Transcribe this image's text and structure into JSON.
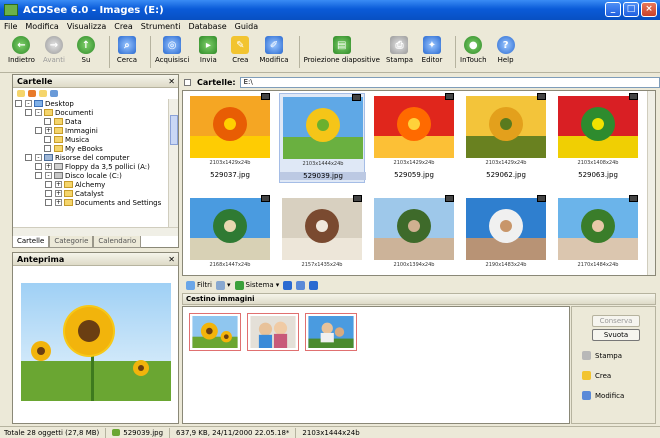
{
  "window": {
    "title": "ACDSee 6.0 - Images (E:)"
  },
  "menu": [
    "File",
    "Modifica",
    "Visualizza",
    "Crea",
    "Strumenti",
    "Database",
    "Guida"
  ],
  "toolbar": [
    {
      "label": "Indietro",
      "icon": "back-arrow-icon"
    },
    {
      "label": "Avanti",
      "icon": "forward-arrow-icon"
    },
    {
      "label": "Su",
      "icon": "up-arrow-icon"
    },
    {
      "label": "Cerca",
      "icon": "search-icon"
    },
    {
      "label": "Acquisisci",
      "icon": "acquire-icon"
    },
    {
      "label": "Invia",
      "icon": "send-icon"
    },
    {
      "label": "Crea",
      "icon": "create-icon"
    },
    {
      "label": "Modifica",
      "icon": "edit-icon"
    },
    {
      "label": "Proiezione diapositive",
      "icon": "slideshow-icon"
    },
    {
      "label": "Stampa",
      "icon": "print-icon"
    },
    {
      "label": "Editor",
      "icon": "editor-icon"
    },
    {
      "label": "InTouch",
      "icon": "intouch-icon"
    },
    {
      "label": "Help",
      "icon": "help-icon"
    }
  ],
  "folders": {
    "title": "Cartelle",
    "tree": [
      {
        "label": "Desktop",
        "indent": 0
      },
      {
        "label": "Documenti",
        "indent": 1
      },
      {
        "label": "Data",
        "indent": 2
      },
      {
        "label": "Immagini",
        "indent": 2
      },
      {
        "label": "Musica",
        "indent": 2
      },
      {
        "label": "My eBooks",
        "indent": 2
      },
      {
        "label": "Risorse del computer",
        "indent": 1
      },
      {
        "label": "Floppy da 3,5 pollici (A:)",
        "indent": 2
      },
      {
        "label": "Disco locale (C:)",
        "indent": 2
      },
      {
        "label": "Alchemy",
        "indent": 3
      },
      {
        "label": "Catalyst",
        "indent": 3
      },
      {
        "label": "Documents and Settings",
        "indent": 3
      }
    ],
    "tabs": [
      "Cartelle",
      "Categorie",
      "Calendario"
    ]
  },
  "preview": {
    "title": "Anteprima"
  },
  "address": {
    "label": "Cartelle:",
    "value": "E:\\"
  },
  "thumbnails": [
    {
      "meta": "2103x1429x24b",
      "name": "529037.jpg",
      "colors": [
        "#f5a623",
        "#e85d04",
        "#ffd000"
      ]
    },
    {
      "meta": "2103x1444x24b",
      "name": "529039.jpg",
      "colors": [
        "#5fa8e6",
        "#f5c518",
        "#6bb02e"
      ],
      "selected": true
    },
    {
      "meta": "2103x1429x24b",
      "name": "529059.jpg",
      "colors": [
        "#e0261c",
        "#ff6a00",
        "#ffd23a"
      ]
    },
    {
      "meta": "2103x1429x24b",
      "name": "529062.jpg",
      "colors": [
        "#f3c43a",
        "#e3a01c",
        "#5a7a1e"
      ]
    },
    {
      "meta": "2103x1408x24b",
      "name": "529063.jpg",
      "colors": [
        "#d91f24",
        "#2e8b2e",
        "#f2e200"
      ]
    },
    {
      "meta": "2168x1447x24b",
      "name": "",
      "colors": [
        "#4a9be0",
        "#2f7a33",
        "#e8d7b0"
      ]
    },
    {
      "meta": "2157x1435x24b",
      "name": "",
      "colors": [
        "#d8d0c0",
        "#7a4a30",
        "#f0e8dc"
      ]
    },
    {
      "meta": "2100x1394x24b",
      "name": "",
      "colors": [
        "#9ec8ea",
        "#3e6a2a",
        "#d0b090"
      ]
    },
    {
      "meta": "2190x1483x24b",
      "name": "",
      "colors": [
        "#2f7fcf",
        "#f0f0f0",
        "#c8966a"
      ]
    },
    {
      "meta": "2170x1484x24b",
      "name": "",
      "colors": [
        "#6bb4ea",
        "#3a7d2a",
        "#e8c8a8"
      ]
    }
  ],
  "filterbar": {
    "filters": "Filtri",
    "sort": "Sistema"
  },
  "basket": {
    "title": "Cestino immagini",
    "buttons": {
      "save": "Conserva",
      "empty": "Svuota"
    },
    "actions": [
      "Stampa",
      "Crea",
      "Modifica"
    ]
  },
  "status": {
    "total": "Totale 28 oggetti  (27,8 MB)",
    "file": "529039.jpg",
    "info": "637,9 KB, 24/11/2000 22.05.18*",
    "dims": "2103x1444x24b"
  }
}
